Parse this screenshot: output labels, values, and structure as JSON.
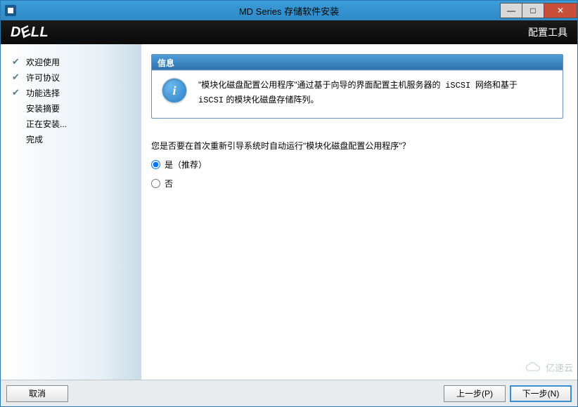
{
  "titlebar": {
    "title": "MD Series 存储软件安装"
  },
  "header": {
    "rightText": "配置工具",
    "logo": "DELL"
  },
  "sidebar": {
    "steps": [
      {
        "label": "欢迎使用",
        "done": true
      },
      {
        "label": "许可协议",
        "done": true
      },
      {
        "label": "功能选择",
        "done": true
      },
      {
        "label": "安装摘要",
        "done": false
      },
      {
        "label": "正在安装...",
        "done": false
      },
      {
        "label": "完成",
        "done": false
      }
    ]
  },
  "info": {
    "heading": "信息",
    "line1a": "\"模块化磁盘配置公用程序\"通过基于向导的界面配置主机服务器的",
    "line1b": "iSCSI",
    "line1c": "网络和基于",
    "line2a": "iSCSI",
    "line2b": "的模块化磁盘存储阵列。"
  },
  "question": "您是否要在首次重新引导系统时自动运行\"模块化磁盘配置公用程序\"？",
  "options": {
    "yes": "是（推荐）",
    "no": "否"
  },
  "buttons": {
    "cancel": "取消",
    "prev": "上一步(P)",
    "next": "下一步(N)"
  },
  "watermark": "亿速云"
}
